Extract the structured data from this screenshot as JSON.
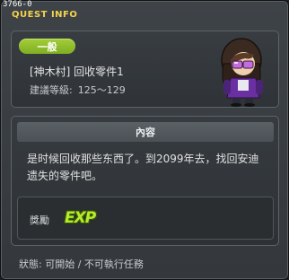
{
  "window": {
    "quest_id": "3766-0",
    "title": "QUEST INFO"
  },
  "quest": {
    "category_tag": "一般",
    "name": "[神木村] 回收零件1",
    "level_label": "建議等級:",
    "level_range": "125～129"
  },
  "content": {
    "header": "內容",
    "description": "是时候回收那些东西了。到2099年去，找回安迪遗失的零件吧。"
  },
  "reward": {
    "label": "獎勵",
    "icon_text": "EXP",
    "icon": "exp-icon"
  },
  "status": {
    "text": "狀態: 可開始 / 不可執行任務"
  },
  "colors": {
    "title": "#f3d34a",
    "tag": "#8dbc2a",
    "exp": "#b6ec2c"
  }
}
